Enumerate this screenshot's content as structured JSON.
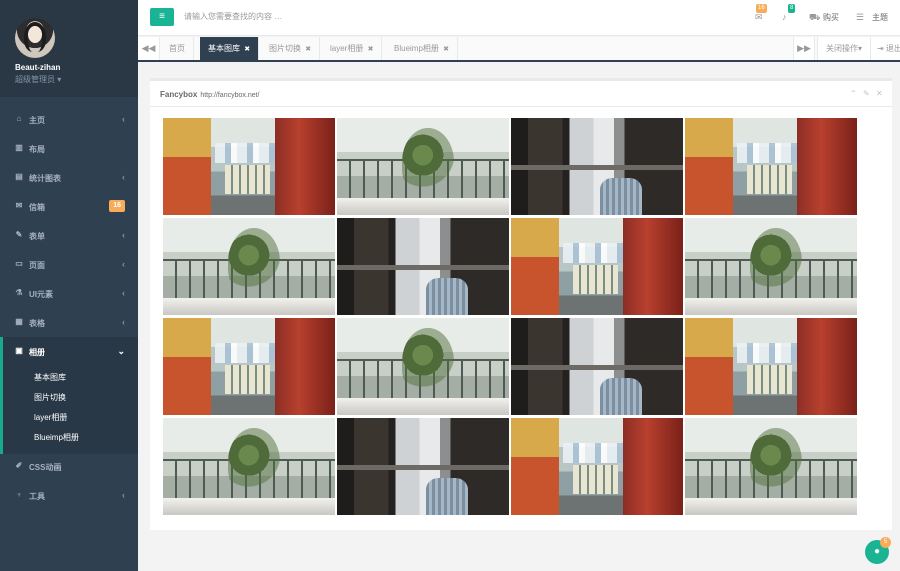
{
  "profile": {
    "name": "Beaut-zihan",
    "role": "超级管理员 ▾"
  },
  "sidebar": {
    "items": [
      {
        "label": "主页",
        "icon": "home-icon",
        "glyph": "⌂",
        "arrow": "‹"
      },
      {
        "label": "布局",
        "icon": "columns-icon",
        "glyph": "▥",
        "arrow": ""
      },
      {
        "label": "统计图表",
        "icon": "bar-chart-icon",
        "glyph": "▤",
        "arrow": "‹"
      },
      {
        "label": "信箱",
        "icon": "envelope-icon",
        "glyph": "✉",
        "badge": "16"
      },
      {
        "label": "表单",
        "icon": "edit-icon",
        "glyph": "✎",
        "arrow": "‹"
      },
      {
        "label": "页面",
        "icon": "desktop-icon",
        "glyph": "▭",
        "arrow": "‹"
      },
      {
        "label": "UI元素",
        "icon": "flask-icon",
        "glyph": "⚗",
        "arrow": "‹"
      },
      {
        "label": "表格",
        "icon": "table-icon",
        "glyph": "▦",
        "arrow": "‹"
      },
      {
        "label": "相册",
        "icon": "picture-icon",
        "glyph": "▣",
        "arrow": "⌄"
      },
      {
        "label": "CSS动画",
        "icon": "magic-icon",
        "glyph": "✐",
        "arrow": ""
      },
      {
        "label": "工具",
        "icon": "cutlery-icon",
        "glyph": "♆",
        "arrow": "‹"
      }
    ],
    "submenu": [
      "基本图库",
      "图片切换",
      "layer相册",
      "Blueimp相册"
    ]
  },
  "topbar": {
    "menu_glyph": "≡",
    "search_placeholder": "请输入您需要查找的内容 …",
    "mail_badge": "16",
    "bell_badge": "8",
    "buy_label": "购买",
    "theme_label": "主题"
  },
  "tabs": {
    "prev_glyph": "◀◀",
    "next_glyph": "▶▶",
    "items": [
      {
        "label": "首页",
        "close": ""
      },
      {
        "label": "基本图库",
        "close": "✖"
      },
      {
        "label": "图片切换",
        "close": "✖"
      },
      {
        "label": "layer相册",
        "close": "✖"
      },
      {
        "label": "Blueimp相册",
        "close": "✖"
      }
    ],
    "close_ops": "关闭操作▾",
    "logout": "⇥ 退出"
  },
  "panel": {
    "title": "Fancybox",
    "subtitle": "http://fancybox.net/",
    "tools": [
      "⌃",
      "✎",
      "✕"
    ]
  },
  "gallery": {
    "rows": [
      [
        "street",
        "plant",
        "window",
        "street"
      ],
      [
        "plant",
        "window",
        "street",
        "plant"
      ],
      [
        "street",
        "plant",
        "window",
        "street"
      ],
      [
        "plant",
        "window",
        "street",
        "plant"
      ]
    ]
  },
  "chat": {
    "glyph": "●",
    "badge": "5"
  },
  "colors": {
    "accent": "#1ab394",
    "sidebar": "#2f4050",
    "badge": "#f8ac59"
  }
}
